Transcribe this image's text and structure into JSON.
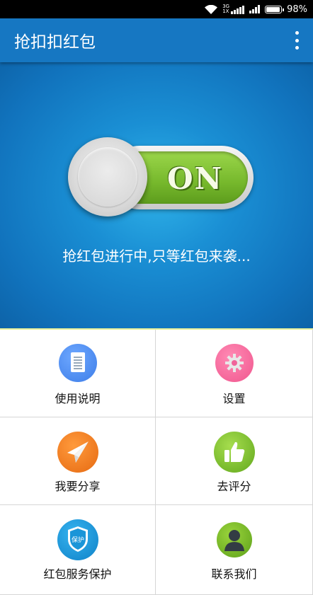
{
  "status_bar": {
    "network_type": "3G",
    "network_sub": "1X",
    "battery_percent": "98%",
    "battery_level": 0.98,
    "icons": [
      "wifi-icon",
      "signal-icon",
      "battery-icon"
    ]
  },
  "app_bar": {
    "title": "抢扣扣红包",
    "menu_icon": "overflow-menu-icon"
  },
  "hero": {
    "toggle_label": "ON",
    "toggle_state": "on",
    "status_text": "抢红包进行中,只等红包来袭..."
  },
  "grid": {
    "items": [
      {
        "label": "使用说明",
        "icon": "document-icon",
        "color": "#4a8cf2"
      },
      {
        "label": "设置",
        "icon": "gear-icon",
        "color": "#f0649a"
      },
      {
        "label": "我要分享",
        "icon": "paper-plane-icon",
        "color": "#f07a1e"
      },
      {
        "label": "去评分",
        "icon": "thumbs-up-icon",
        "color": "#7cc12e"
      },
      {
        "label": "红包服务保护",
        "icon": "shield-icon",
        "shield_text": "保护",
        "color": "#1a95d8"
      },
      {
        "label": "联系我们",
        "icon": "user-icon",
        "color": "#74b52a"
      }
    ]
  },
  "colors": {
    "app_bar": "#1677c2",
    "hero_center": "#2fb2e8",
    "hero_edge": "#0d63a8",
    "toggle_green": "#7cc12e"
  }
}
